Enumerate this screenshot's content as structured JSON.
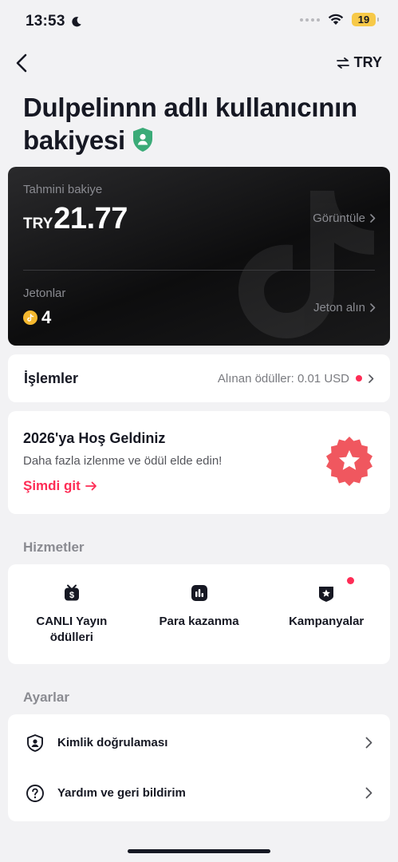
{
  "status_bar": {
    "time": "13:53",
    "battery": "19"
  },
  "nav": {
    "currency": "TRY"
  },
  "page": {
    "title": "Dulpelinnn adlı kullanıcının bakiyesi"
  },
  "balance": {
    "label": "Tahmini bakiye",
    "currency": "TRY",
    "amount": "21.77",
    "view_link": "Görüntüle",
    "coins_label": "Jetonlar",
    "coins_value": "4",
    "get_coins_link": "Jeton alın"
  },
  "transactions": {
    "title": "İşlemler",
    "summary": "Alınan ödüller: 0.01 USD"
  },
  "promo": {
    "title": "2026'ya Hoş Geldiniz",
    "subtitle": "Daha fazla izlenme ve ödül elde edin!",
    "cta": "Şimdi git"
  },
  "services": {
    "label": "Hizmetler",
    "items": [
      {
        "label": "CANLI Yayın ödülleri",
        "icon": "live-reward-icon"
      },
      {
        "label": "Para kazanma",
        "icon": "chart-icon"
      },
      {
        "label": "Kampanyalar",
        "icon": "campaign-badge-icon"
      }
    ]
  },
  "settings": {
    "label": "Ayarlar",
    "items": [
      {
        "label": "Kimlik doğrulaması",
        "icon": "shield-user-icon"
      },
      {
        "label": "Yardım ve geri bildirim",
        "icon": "help-icon"
      }
    ]
  },
  "colors": {
    "accent": "#fe2c55",
    "coin": "#f5b82e",
    "verified": "#3bab78"
  }
}
